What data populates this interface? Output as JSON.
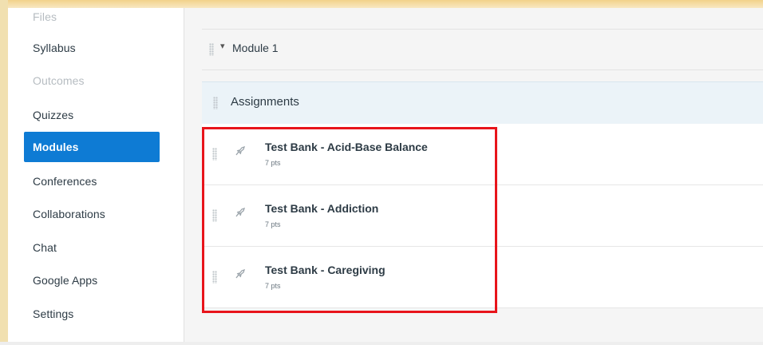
{
  "sidebar": {
    "items": [
      {
        "label": "Files",
        "state": "disabled"
      },
      {
        "label": "Syllabus",
        "state": "normal"
      },
      {
        "label": "Outcomes",
        "state": "disabled"
      },
      {
        "label": "Quizzes",
        "state": "normal"
      },
      {
        "label": "Modules",
        "state": "active"
      },
      {
        "label": "Conferences",
        "state": "normal"
      },
      {
        "label": "Collaborations",
        "state": "normal"
      },
      {
        "label": "Chat",
        "state": "normal"
      },
      {
        "label": "Google Apps",
        "state": "normal"
      },
      {
        "label": "Settings",
        "state": "normal"
      }
    ]
  },
  "module": {
    "title": "Module 1",
    "caret": "▾"
  },
  "group": {
    "title": "Assignments"
  },
  "items": [
    {
      "title": "Test Bank - Acid-Base Balance",
      "points": "7 pts",
      "icon": "quiz-rocket-icon"
    },
    {
      "title": "Test Bank - Addiction",
      "points": "7 pts",
      "icon": "quiz-rocket-icon"
    },
    {
      "title": "Test Bank - Caregiving",
      "points": "7 pts",
      "icon": "quiz-rocket-icon"
    }
  ],
  "colors": {
    "active_nav": "#0e7bd4",
    "highlight_border": "#e8141b"
  }
}
